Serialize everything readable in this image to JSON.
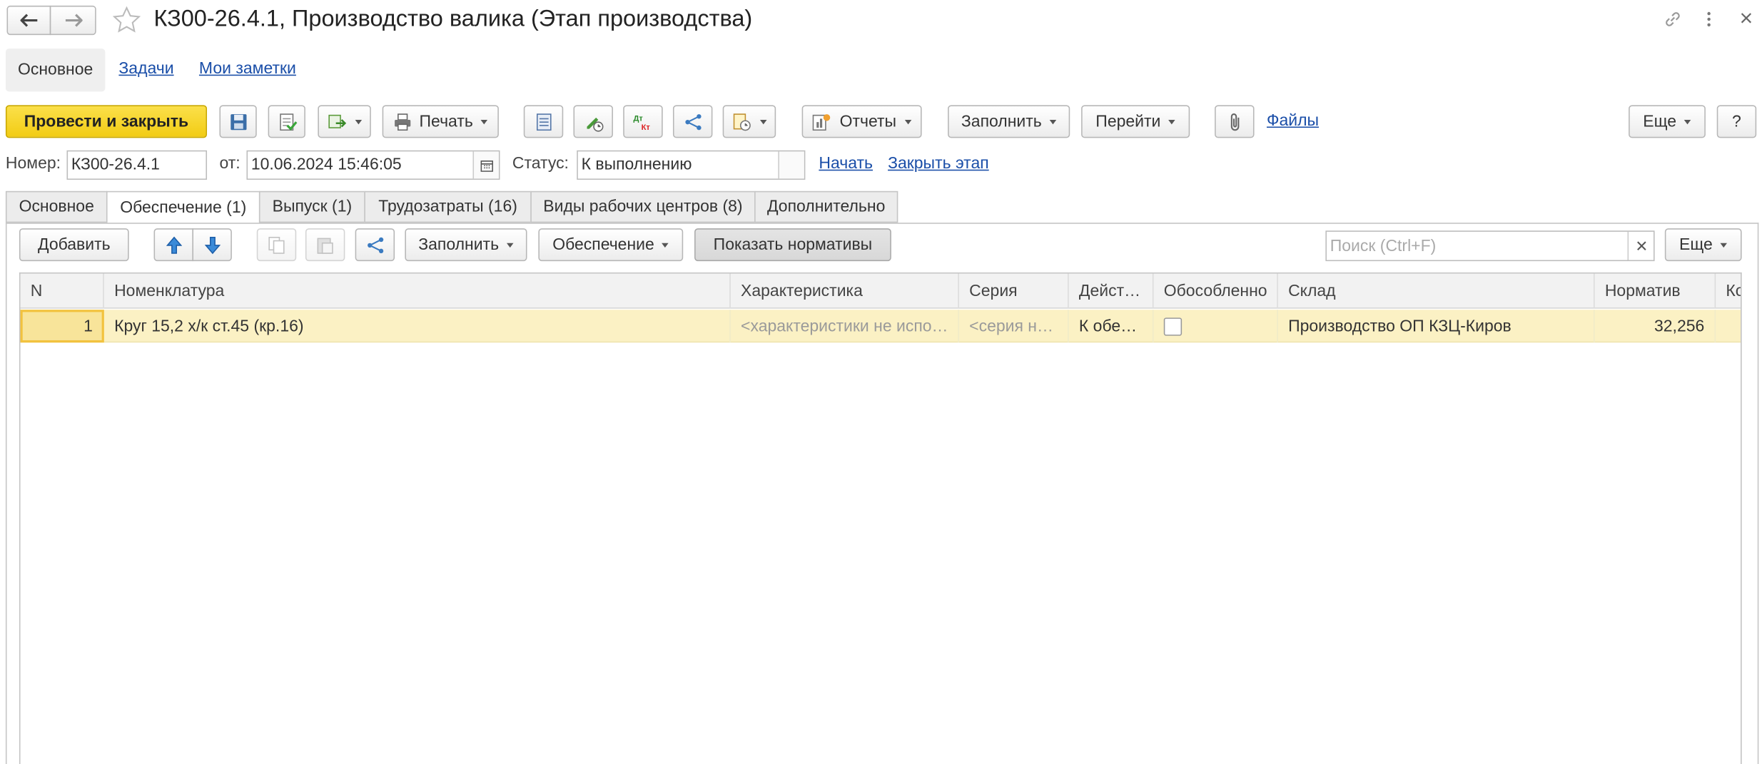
{
  "title_bar": {
    "title": "КЗ00-26.4.1, Производство валика (Этап производства)",
    "back_icon": "arrow-left-icon",
    "forward_icon": "arrow-right-icon",
    "favorite_icon": "star-icon",
    "link_icon": "link-icon",
    "more_icon": "vertical-dots-icon",
    "close_icon": "close-icon"
  },
  "nav": {
    "main": "Основное",
    "tasks": "Задачи",
    "notes": "Мои заметки"
  },
  "toolbar": {
    "post_close": "Провести и закрыть",
    "print": "Печать",
    "reports": "Отчеты",
    "fill": "Заполнить",
    "go": "Перейти",
    "files": "Файлы",
    "more": "Еще",
    "help": "?",
    "accent_color": "#f7d51b"
  },
  "header": {
    "number_label": "Номер:",
    "number_value": "КЗ00-26.4.1",
    "date_label": "от:",
    "date_value": "10.06.2024 15:46:05",
    "status_label": "Статус:",
    "status_value": "К выполнению",
    "start_link": "Начать",
    "close_stage_link": "Закрыть этап"
  },
  "tabs": [
    {
      "label": "Основное"
    },
    {
      "label": "Обеспечение (1)"
    },
    {
      "label": "Выпуск (1)"
    },
    {
      "label": "Трудозатраты (16)"
    },
    {
      "label": "Виды рабочих центров (8)"
    },
    {
      "label": "Дополнительно"
    }
  ],
  "table_toolbar": {
    "add": "Добавить",
    "fill": "Заполнить",
    "supply": "Обеспечение",
    "show_norms": "Показать нормативы",
    "search_placeholder": "Поиск (Ctrl+F)",
    "more": "Еще"
  },
  "table": {
    "columns": [
      "N",
      "Номенклатура",
      "Характеристика",
      "Серия",
      "Дейст…",
      "Обособленно",
      "Склад",
      "Норматив",
      "Ко"
    ],
    "rows": [
      {
        "n": "1",
        "nomenclature": "Круг 15,2 х/к ст.45 (кр.16)",
        "characteristic": "<характеристики не испо…",
        "series": "<серия н…",
        "action": "К обе…",
        "separate": false,
        "warehouse": "Производство ОП КЗЦ-Киров",
        "norm": "32,256",
        "extra": ""
      }
    ]
  }
}
